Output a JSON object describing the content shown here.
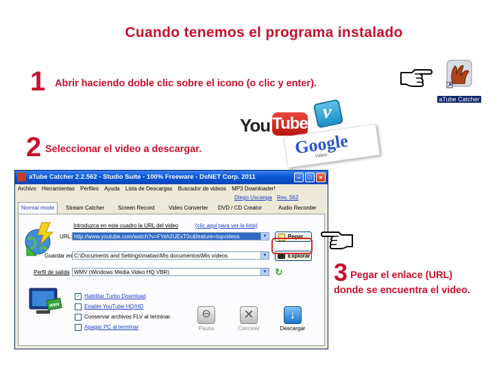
{
  "slide": {
    "title": "Cuando tenemos el programa  instalado",
    "step1": {
      "number": "1",
      "text": "Abrir  haciendo doble clic sobre el icono (o clic y enter)."
    },
    "step2": {
      "number": "2",
      "text": "Seleccionar el video  a descargar."
    },
    "step3": {
      "number": "3",
      "line1": "Pegar el enlace (URL)",
      "line2": "donde se encuentra el video."
    },
    "app_icon_label": "aTube Catcher",
    "logos": {
      "youtube_you": "You",
      "youtube_tube": "Tube",
      "vimeo": "v",
      "google": "Google",
      "google_sub": "Video"
    },
    "colors": {
      "accent": "#c8102e",
      "xp_blue": "#0a57d6"
    }
  },
  "window": {
    "title": "aTube Catcher 2.2.562 - Studio Suite - 100% Freeware - DsNET Corp. 2011",
    "menu": [
      "Archivo",
      "Herramientas",
      "Perfiles",
      "Ayuda",
      "Lista de Descargas",
      "Buscador de videos",
      "MP3 Downloader!"
    ],
    "author_link": "Diego Uscanga",
    "rev_link": "Rev. 562",
    "tabs": [
      "Normal mode",
      "Stream Catcher",
      "Screen Record",
      "Video Converter",
      "DVD / CD Creator",
      "Audio Recorder"
    ],
    "url_hint": "Introduzca en este cuadro la URL del video",
    "list_link": "(clic aqui para ver la lista)",
    "url_label": "URL:",
    "url_value": "http://www.youtube.com/watch?v=FYeh2UExT0c&feature=topvideos",
    "paste_label": "Pegar",
    "save_label": "Guardar en:",
    "save_value": "C:\\Documents and Settings\\matias\\Mis documentos\\Mis vídeos",
    "browse_label": "Explorar",
    "profile_label": "Perfil de salida",
    "profile_value": "WMV (Windows Media Video HQ VBR)",
    "options": [
      {
        "label": "Habilitar Turbo Download",
        "checked": true
      },
      {
        "label": "Enable YouTube HQ/HD",
        "checked": false
      },
      {
        "label": "Conservar archivos FLV al terminar",
        "checked": false
      },
      {
        "label": "Apagar PC al terminar",
        "checked": false
      }
    ],
    "pause_label": "Pausa",
    "cancel_label": "Cancelar",
    "download_label": "Descargar",
    "wmv_label": "WMV"
  }
}
